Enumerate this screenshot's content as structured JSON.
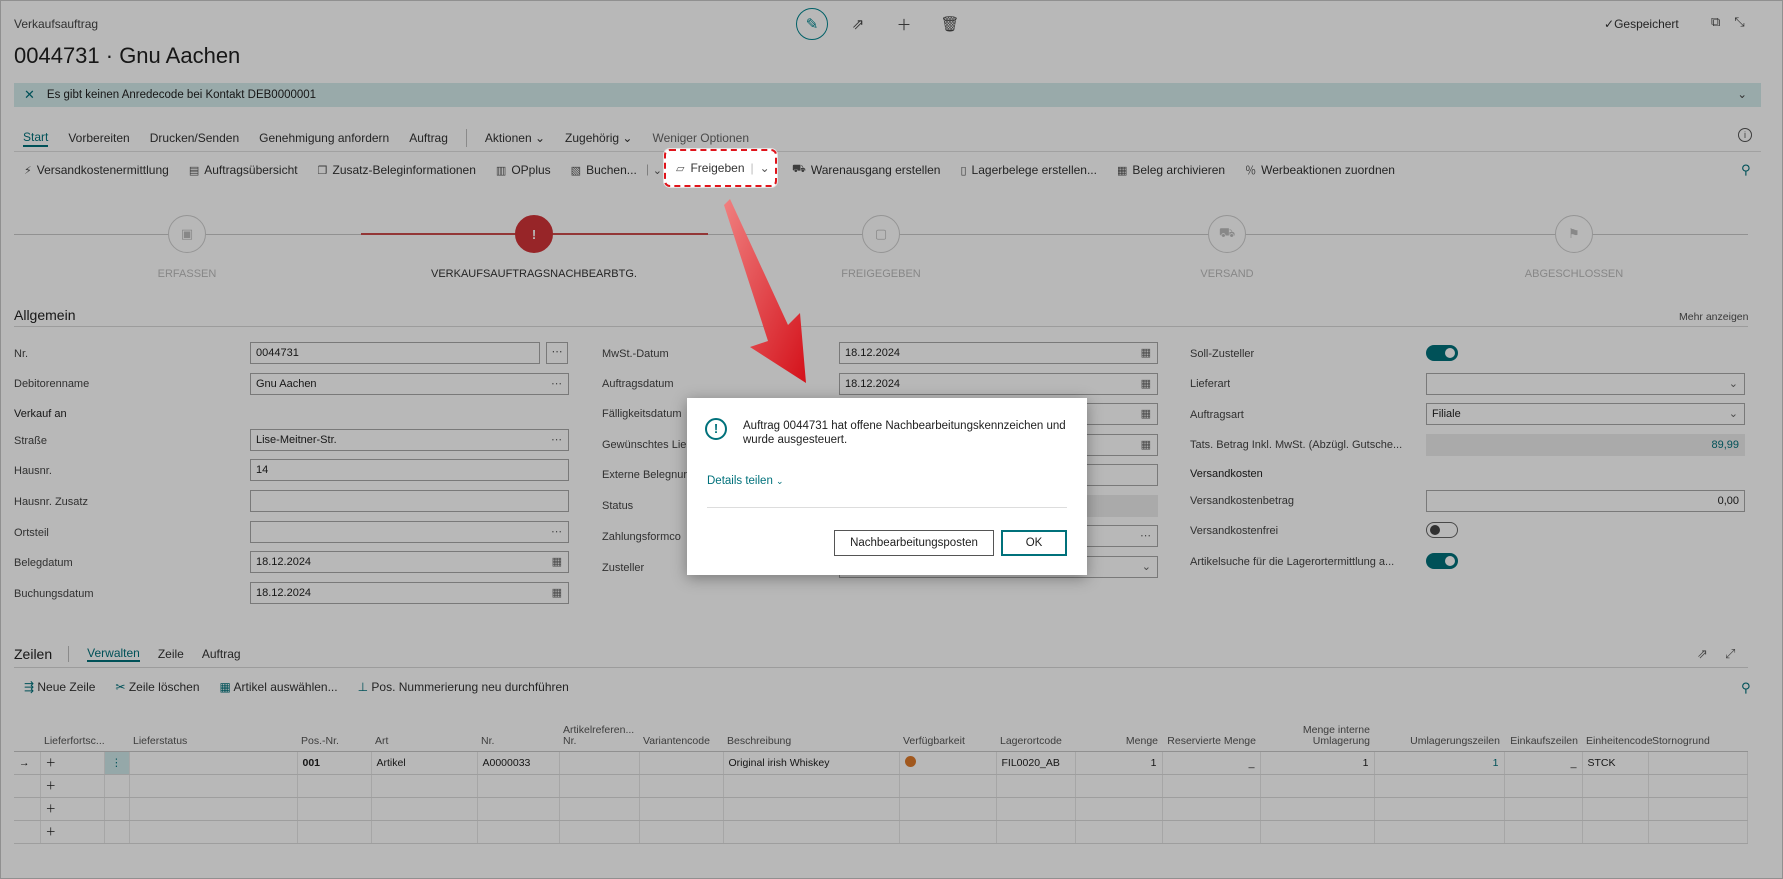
{
  "header": {
    "kind": "Verkaufsauftrag",
    "title": "0044731 · Gnu Aachen",
    "saved": "Gespeichert"
  },
  "notification": {
    "text": "Es gibt keinen Anredecode bei Kontakt DEB0000001"
  },
  "menu": {
    "items": [
      "Start",
      "Vorbereiten",
      "Drucken/Senden",
      "Genehmigung anfordern",
      "Auftrag"
    ],
    "more": [
      "Aktionen",
      "Zugehörig"
    ],
    "fewer": "Weniger Optionen"
  },
  "actions": {
    "a1": "Versandkostenermittlung",
    "a2": "Auftragsübersicht",
    "a3": "Zusatz-Beleginformationen",
    "a4": "OPplus",
    "a5": "Buchen...",
    "a6": "Freigeben",
    "a7": "Warenausgang erstellen",
    "a8": "Lagerbelege erstellen...",
    "a9": "Beleg archivieren",
    "a10": "Werbeaktionen zuordnen"
  },
  "steps": [
    "ERFASSEN",
    "VERKAUFSAUFTRAGSNACHBEARBTG.",
    "FREIGEGEBEN",
    "VERSAND",
    "ABGESCHLOSSEN"
  ],
  "general": {
    "title": "Allgemein",
    "more": "Mehr anzeigen",
    "nr_label": "Nr.",
    "nr": "0044731",
    "debitor_label": "Debitorenname",
    "debitor": "Gnu Aachen",
    "verkauf_an": "Verkauf an",
    "strasse_label": "Straße",
    "strasse": "Lise-Meitner-Str.",
    "hausnr_label": "Hausnr.",
    "hausnr": "14",
    "hausnr_zusatz_label": "Hausnr. Zusatz",
    "hausnr_zusatz": "",
    "ortsteil_label": "Ortsteil",
    "ortsteil": "",
    "belegdatum_label": "Belegdatum",
    "belegdatum": "18.12.2024",
    "buchungsdatum_label": "Buchungsdatum",
    "buchungsdatum": "18.12.2024",
    "mwst_label": "MwSt.-Datum",
    "mwst": "18.12.2024",
    "auftragsdatum_label": "Auftragsdatum",
    "auftragsdatum": "18.12.2024",
    "faellig_label": "Fälligkeitsdatum",
    "gewuenscht_label": "Gewünschtes Lie",
    "extern_label": "Externe Belegnur",
    "status_label": "Status",
    "zahlung_label": "Zahlungsformco",
    "zusteller_label": "Zusteller",
    "soll_label": "Soll-Zusteller",
    "lieferart_label": "Lieferart",
    "lieferart": "",
    "auftragsart_label": "Auftragsart",
    "auftragsart": "Filiale",
    "tats_label": "Tats. Betrag Inkl. MwSt. (Abzügl. Gutsche...",
    "tats": "89,99",
    "versandkosten": "Versandkosten",
    "vk_betrag_label": "Versandkostenbetrag",
    "vk_betrag": "0,00",
    "vk_frei_label": "Versandkostenfrei",
    "artikelsuche_label": "Artikelsuche für die Lagerortermittlung a..."
  },
  "lines": {
    "title": "Zeilen",
    "tabs": [
      "Verwalten",
      "Zeile",
      "Auftrag"
    ],
    "actions": [
      "Neue Zeile",
      "Zeile löschen",
      "Artikel auswählen...",
      "Pos. Nummerierung neu durchführen"
    ],
    "columns": [
      "Lieferfortsc...",
      "Lieferstatus",
      "Pos.-Nr.",
      "Art",
      "Nr.",
      "Artikelreferen... Nr.",
      "Variantencode",
      "Beschreibung",
      "Verfügbarkeit",
      "Lagerortcode",
      "Menge",
      "Reservierte Menge",
      "Menge interne Umlagerung",
      "Umlagerungszeilen",
      "Einkaufszeilen",
      "Einheitencode",
      "Stornogrund"
    ],
    "row": {
      "pos": "001",
      "art": "Artikel",
      "nr": "A0000033",
      "beschreibung": "Original irish Whiskey",
      "lagerort": "FIL0020_AB",
      "menge": "1",
      "reserviert": "_",
      "umlagerung": "1",
      "umlagerungszeilen": "1",
      "einkauf": "_",
      "einheit": "STCK"
    }
  },
  "dialog": {
    "message": "Auftrag 0044731 hat offene Nachbearbeitungskennzeichen und wurde ausgesteuert.",
    "details": "Details teilen",
    "btn_secondary": "Nachbearbeitungsposten",
    "btn_ok": "OK"
  },
  "colors": {
    "accent": "#00717b",
    "alert": "#d13438",
    "highlight": "#e0141b"
  }
}
